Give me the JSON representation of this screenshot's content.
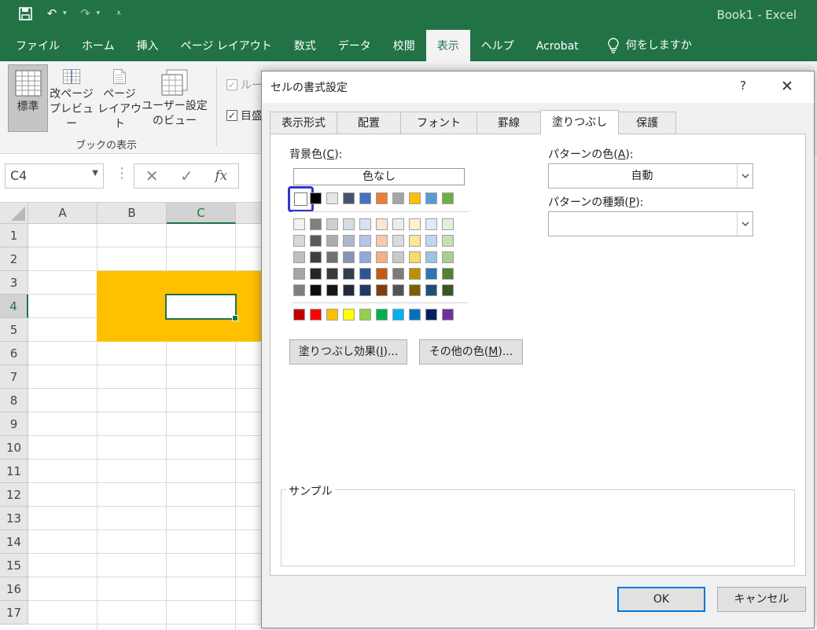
{
  "app": {
    "doc_title": "Book1  -  Excel"
  },
  "ribbon_tabs": [
    {
      "label": "ファイル"
    },
    {
      "label": "ホーム"
    },
    {
      "label": "挿入"
    },
    {
      "label": "ページ レイアウト"
    },
    {
      "label": "数式"
    },
    {
      "label": "データ"
    },
    {
      "label": "校閲"
    },
    {
      "label": "表示",
      "active": true
    },
    {
      "label": "ヘルプ"
    },
    {
      "label": "Acrobat"
    }
  ],
  "tell_me": "何をしますか",
  "ribbon": {
    "normal_label": "標準",
    "page_break_line1": "改ページ",
    "page_break_line2": "プレビュー",
    "page_layout_line1": "ページ",
    "page_layout_line2": "レイアウト",
    "custom_view_line1": "ユーザー設定",
    "custom_view_line2": "のビュー",
    "group_label": "ブックの表示",
    "check_ruler": "ルー",
    "check_gridlines": "目盛"
  },
  "formula_bar": {
    "name_box": "C4",
    "fx": "fx"
  },
  "columns": [
    "A",
    "B",
    "C"
  ],
  "rows": [
    "1",
    "2",
    "3",
    "4",
    "5",
    "6",
    "7",
    "8",
    "9",
    "10",
    "11",
    "12",
    "13",
    "14",
    "15",
    "16",
    "17"
  ],
  "selected_cell_fill": "#ffc000",
  "dialog": {
    "title": "セルの書式設定",
    "help": "?",
    "close": "✕",
    "tabs": [
      {
        "label": "表示形式"
      },
      {
        "label": "配置"
      },
      {
        "label": "フォント"
      },
      {
        "label": "罫線"
      },
      {
        "label": "塗りつぶし",
        "active": true
      },
      {
        "label": "保護"
      }
    ],
    "bg_color_label": "背景色(",
    "bg_color_key": "C",
    "bg_color_suffix": "):",
    "no_color": "色なし",
    "fill_effects_label": "塗りつぶし効果(",
    "fill_effects_key": "I",
    "fill_effects_suffix": ")...",
    "more_colors_label": "その他の色(",
    "more_colors_key": "M",
    "more_colors_suffix": ")...",
    "pattern_color_label": "パターンの色(",
    "pattern_color_key": "A",
    "pattern_color_suffix": "):",
    "pattern_color_value": "自動",
    "pattern_style_label": "パターンの種類(",
    "pattern_style_key": "P",
    "pattern_style_suffix": "):",
    "pattern_style_value": "",
    "sample_label": "サンプル",
    "ok": "OK",
    "cancel": "キャンセル",
    "palette": {
      "theme_top": [
        "#ffffff",
        "#000000",
        "#e7e6e6",
        "#44546a",
        "#4472c4",
        "#ed7d31",
        "#a5a5a5",
        "#ffc000",
        "#5b9bd5",
        "#70ad47"
      ],
      "theme_shades": [
        [
          "#f2f2f2",
          "#7f7f7f",
          "#d0cece",
          "#d6dce4",
          "#d9e2f3",
          "#fbe5d5",
          "#ededed",
          "#fff2cc",
          "#deebf6",
          "#e2efd9"
        ],
        [
          "#d8d8d8",
          "#595959",
          "#aeabab",
          "#adb9ca",
          "#b4c6e7",
          "#f7caac",
          "#dbdbdb",
          "#fee599",
          "#bdd7ee",
          "#c5e0b3"
        ],
        [
          "#bfbfbf",
          "#3f3f3f",
          "#757070",
          "#8496b0",
          "#8eaadb",
          "#f4b183",
          "#c9c9c9",
          "#ffd966",
          "#9cc3e5",
          "#a8d08d"
        ],
        [
          "#a5a5a5",
          "#262626",
          "#3a3838",
          "#323f4f",
          "#2f5496",
          "#c55a11",
          "#7b7b7b",
          "#bf8f00",
          "#2e75b5",
          "#538135"
        ],
        [
          "#7f7f7f",
          "#0c0c0c",
          "#171616",
          "#222a35",
          "#1f3864",
          "#833c0b",
          "#525252",
          "#7f6000",
          "#1f4e79",
          "#375623"
        ]
      ],
      "standard": [
        "#c00000",
        "#ff0000",
        "#ffc000",
        "#ffff00",
        "#92d050",
        "#00b050",
        "#00b0f0",
        "#0070c0",
        "#002060",
        "#7030a0"
      ]
    }
  }
}
